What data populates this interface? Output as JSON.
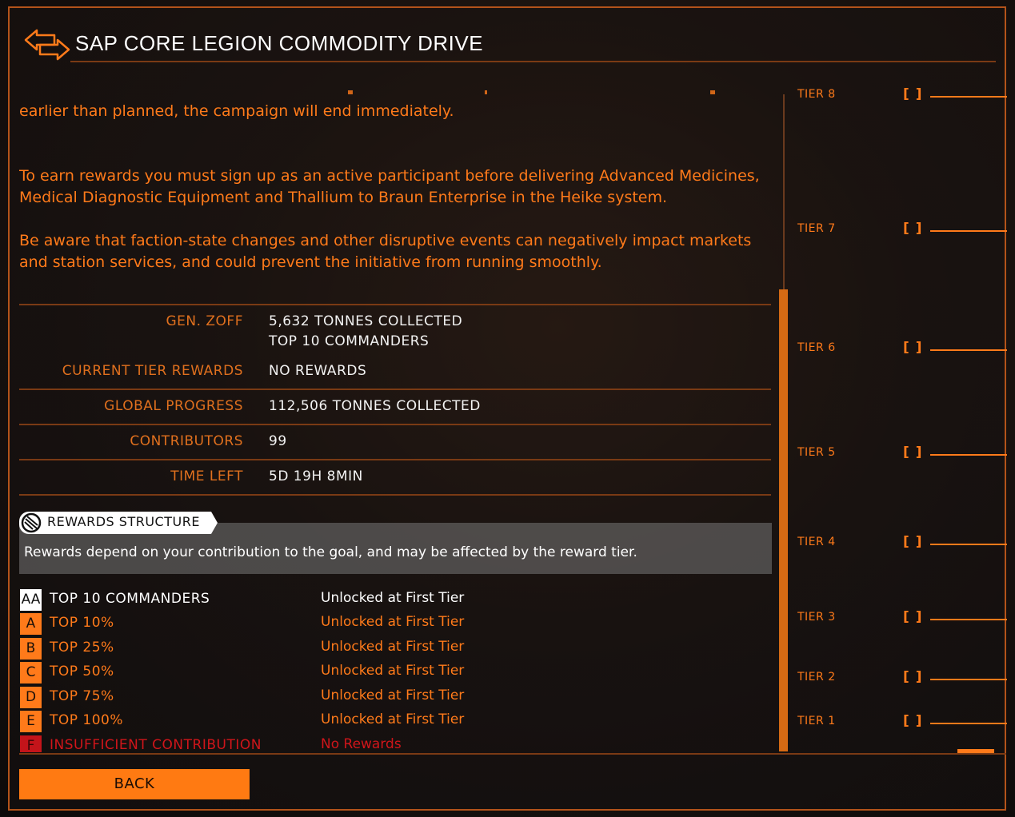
{
  "header": {
    "title": "SAP CORE LEGION COMMODITY DRIVE",
    "back_icon": "back-forward-arrows-icon"
  },
  "description": {
    "partial_line": "earlier than planned, the campaign will end immediately.",
    "paragraph_2": "To earn rewards you must sign up as an active participant before delivering Advanced Medicines, Medical Diagnostic Equipment and Thallium to Braun Enterprise in the Heike system.",
    "paragraph_3": "Be aware that faction-state changes and other disruptive events can negatively impact markets and station services, and could prevent the initiative from running smoothly."
  },
  "stats": {
    "commander_label": "GEN. ZOFF",
    "commander_collected": "5,632 TONNES COLLECTED",
    "commander_rank": "TOP 10 COMMANDERS",
    "current_tier_label": "CURRENT TIER REWARDS",
    "current_tier_value": "NO REWARDS",
    "global_label": "GLOBAL PROGRESS",
    "global_value": "112,506 TONNES COLLECTED",
    "contributors_label": "CONTRIBUTORS",
    "contributors_value": "99",
    "time_label": "TIME LEFT",
    "time_value": "5D 19H 8MIN"
  },
  "rewards": {
    "tab_label": "REWARDS STRUCTURE",
    "tab_icon": "shield-emblem-icon",
    "note": "Rewards depend on your contribution to the goal, and may be affected by the reward tier.",
    "rows": [
      {
        "badge": "AA",
        "name": "TOP 10 COMMANDERS",
        "unlock": "Unlocked at First Tier"
      },
      {
        "badge": "A",
        "name": "TOP 10%",
        "unlock": "Unlocked at First Tier"
      },
      {
        "badge": "B",
        "name": "TOP 25%",
        "unlock": "Unlocked at First Tier"
      },
      {
        "badge": "C",
        "name": "TOP 50%",
        "unlock": "Unlocked at First Tier"
      },
      {
        "badge": "D",
        "name": "TOP 75%",
        "unlock": "Unlocked at First Tier"
      },
      {
        "badge": "E",
        "name": "TOP 100%",
        "unlock": "Unlocked at First Tier"
      },
      {
        "badge": "F",
        "name": "INSUFFICIENT CONTRIBUTION",
        "unlock": "No Rewards"
      }
    ]
  },
  "tier_track": {
    "bracket": "[ ]",
    "tiers": [
      "TIER 8",
      "TIER 7",
      "TIER 6",
      "TIER 5",
      "TIER 4",
      "TIER 3",
      "TIER 2",
      "TIER 1"
    ]
  },
  "footer": {
    "back_label": "BACK"
  },
  "colors": {
    "accent": "#ff7a1a",
    "value_text": "#f3f3f3",
    "divider": "#7a3a14",
    "badge_aa": "#ffffff",
    "badge_f": "#c4141a",
    "no_reward_text": "#d0151a"
  }
}
